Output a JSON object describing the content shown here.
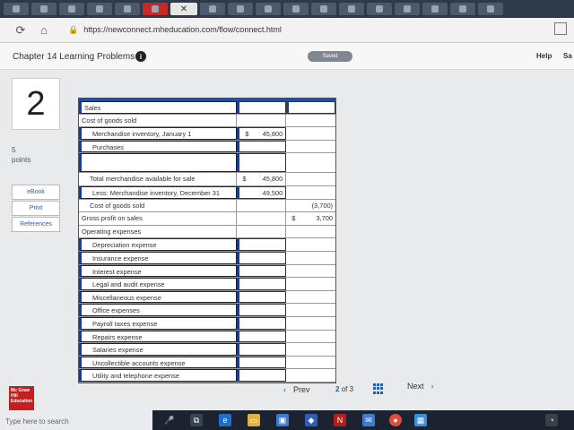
{
  "browser": {
    "url": "https://newconnect.mheducation.com/flow/connect.html",
    "active_tab_close": "✕"
  },
  "header": {
    "title": "Chapter 14 Learning Problems",
    "info_icon": "i",
    "saved_label": "Saved",
    "help_label": "Help",
    "save_exit_label": "Sa"
  },
  "question": {
    "number": "2",
    "points_value": "5",
    "points_label": "points"
  },
  "sidebar": {
    "items": [
      {
        "label": "eBook"
      },
      {
        "label": "Print"
      },
      {
        "label": "References"
      }
    ]
  },
  "worksheet": {
    "rows": [
      {
        "label": "Sales",
        "c1": "",
        "c2": ""
      },
      {
        "label": "Cost of goods sold",
        "c1": "",
        "c2": ""
      },
      {
        "label": "Merchandise inventory, January 1",
        "c1": "45,800",
        "c1_dollar": "$",
        "c2": ""
      },
      {
        "label": "Purchases",
        "c1": "",
        "c2": ""
      },
      {
        "label": "",
        "c1": "",
        "c2": ""
      },
      {
        "label": "Total merchandise available for sale",
        "c1": "45,800",
        "c1_dollar": "$",
        "c2": ""
      },
      {
        "label": "Less: Merchandise inventory, December 31",
        "c1": "49,500",
        "c2": ""
      },
      {
        "label": "Cost of goods sold",
        "c1": "",
        "c2": "(3,700)"
      },
      {
        "label": "Gross profit on sales",
        "c1": "",
        "c2": "3,700",
        "c2_dollar": "$"
      },
      {
        "label": "Operating expenses",
        "c1": "",
        "c2": ""
      },
      {
        "label": "Depreciation expense",
        "c1": "",
        "c2": ""
      },
      {
        "label": "Insurance expense",
        "c1": "",
        "c2": ""
      },
      {
        "label": "Interest expense",
        "c1": "",
        "c2": ""
      },
      {
        "label": "Legal and audit expense",
        "c1": "",
        "c2": ""
      },
      {
        "label": "Miscellaneous expense",
        "c1": "",
        "c2": ""
      },
      {
        "label": "Office expenses",
        "c1": "",
        "c2": ""
      },
      {
        "label": "Payroll taxes expense",
        "c1": "",
        "c2": ""
      },
      {
        "label": "Repairs expense",
        "c1": "",
        "c2": ""
      },
      {
        "label": "Salaries expense",
        "c1": "",
        "c2": ""
      },
      {
        "label": "Uncollectible accounts expense",
        "c1": "",
        "c2": ""
      },
      {
        "label": "Utility and telephone expense",
        "c1": "",
        "c2": ""
      }
    ]
  },
  "pager": {
    "prev_label": "Prev",
    "current": "2",
    "of_label": "of",
    "total": "3",
    "next_label": "Next"
  },
  "brand": {
    "logo_text": "Mc Graw Hill Education"
  },
  "taskbar": {
    "search_placeholder": "Type here to search"
  }
}
